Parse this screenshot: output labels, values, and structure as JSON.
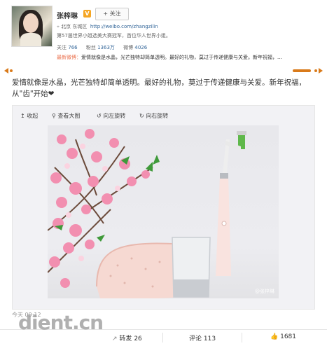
{
  "profile": {
    "name": "张梓琳",
    "follow_label": "+ 关注",
    "location": "北京 东城区",
    "url": "http://weibo.com/zhangzilin",
    "description": "第57届世界小姐选美大赛冠军，首位华人世界小姐。",
    "stats": {
      "follow_label": "关注",
      "follow_value": "766",
      "fans_label": "粉丝",
      "fans_value": "1363万",
      "weibo_label": "微博",
      "weibo_value": "4026"
    },
    "latest_label": "最新微博：",
    "latest_text": "爱情就像是水晶，光芒独特却简单透明。最好的礼物，莫过于传递健康与关爱。新年祝福，...",
    "latest_more": "..."
  },
  "post": {
    "text": "爱情就像是水晶，光芒独特却简单透明。最好的礼物，莫过于传递健康与关爱。新年祝福，从\"齿\"开始❤"
  },
  "media_toolbar": {
    "collapse": "收起",
    "view_large": "查看大图",
    "rotate_left": "向左旋转",
    "rotate_right": "向右旋转"
  },
  "photo": {
    "watermark": "@张梓琳"
  },
  "footer": {
    "time": "今天 09:12",
    "forward_label": "转发",
    "forward_count": "26",
    "comment_label": "评论",
    "comment_count": "113",
    "like_count": "1681"
  },
  "site_logo": "dient.cn",
  "colors": {
    "link": "#336699",
    "accent": "#eb7350",
    "badge": "#f5a623"
  }
}
